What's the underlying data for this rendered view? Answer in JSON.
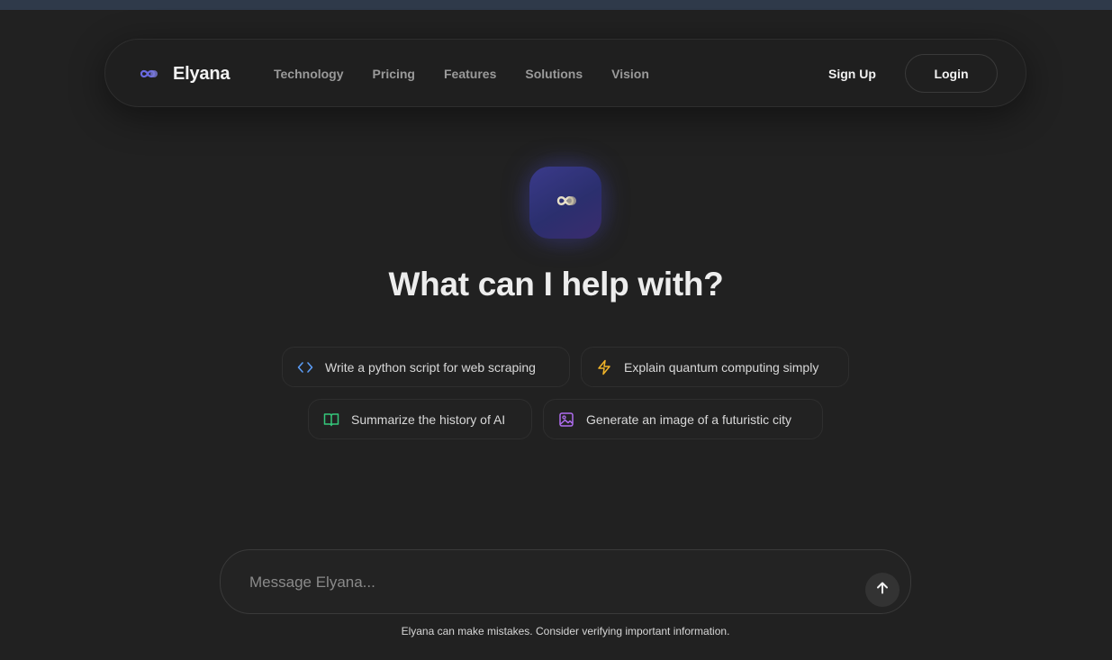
{
  "brand": {
    "name": "Elyana",
    "logo_icon": "infinity-logo-icon"
  },
  "nav": {
    "links": [
      "Technology",
      "Pricing",
      "Features",
      "Solutions",
      "Vision"
    ],
    "signup_label": "Sign Up",
    "login_label": "Login"
  },
  "hero": {
    "logo_icon": "infinity-logo-icon",
    "headline": "What can I help with?"
  },
  "suggestions": [
    {
      "label": "Write a python script for web scraping",
      "icon": "code-icon",
      "color": "#5b9cf5"
    },
    {
      "label": "Explain quantum computing simply",
      "icon": "lightning-icon",
      "color": "#f0b429"
    },
    {
      "label": "Summarize the history of AI",
      "icon": "book-icon",
      "color": "#34c77b"
    },
    {
      "label": "Generate an image of a futuristic city",
      "icon": "image-icon",
      "color": "#b06df0"
    }
  ],
  "composer": {
    "placeholder": "Message Elyana...",
    "send_icon": "arrow-up-icon"
  },
  "disclaimer": "Elyana can make mistakes. Consider verifying important information.",
  "colors": {
    "background": "#212121",
    "accent": "#3a3a8a"
  }
}
